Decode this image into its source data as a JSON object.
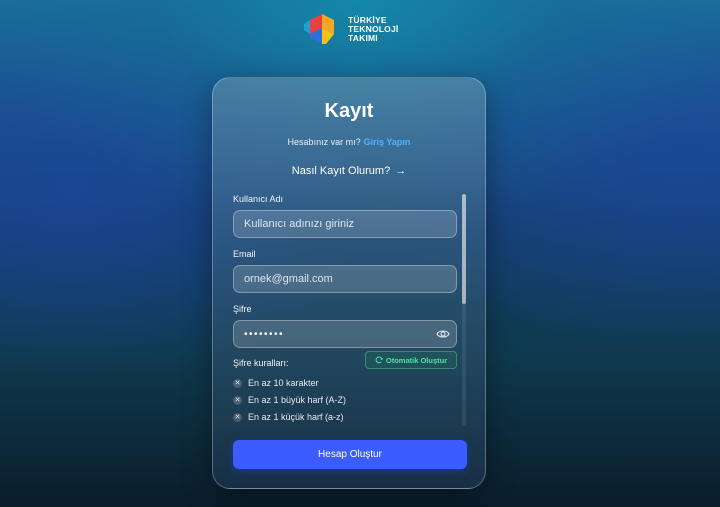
{
  "brand": {
    "logo_lines": [
      "TÜRKİYE",
      "TEKNOLOJİ",
      "TAKIMI"
    ],
    "logo_icon": "tty-logo-icon"
  },
  "card": {
    "title": "Kayıt",
    "have_account_text": "Hesabınız var mı?",
    "login_link": "Giriş Yapın",
    "how_to_register": "Nasıl Kayıt Olurum?",
    "how_to_register_arrow": "→"
  },
  "form": {
    "username": {
      "label": "Kullanıcı Adı",
      "value": "",
      "placeholder": "Kullanıcı adınızı giriniz"
    },
    "email": {
      "label": "Email",
      "value": "",
      "placeholder": "ornek@gmail.com"
    },
    "password": {
      "label": "Şifre",
      "value": "••••••••",
      "toggle_icon": "eye-icon"
    },
    "rules_label": "Şifre kuralları:",
    "auto_generate_label": "Otomatik Oluştur",
    "auto_generate_icon": "refresh-icon",
    "rules": [
      "En az 10 karakter",
      "En az 1 büyük harf (A-Z)",
      "En az 1 küçük harf (a-z)"
    ],
    "rule_status_icon": "x-circle-icon",
    "submit_label": "Hesap Oluştur"
  },
  "colors": {
    "accent_button": "#3b5cff",
    "link": "#4fb3ff",
    "auto_generate": "#54e0a0"
  }
}
